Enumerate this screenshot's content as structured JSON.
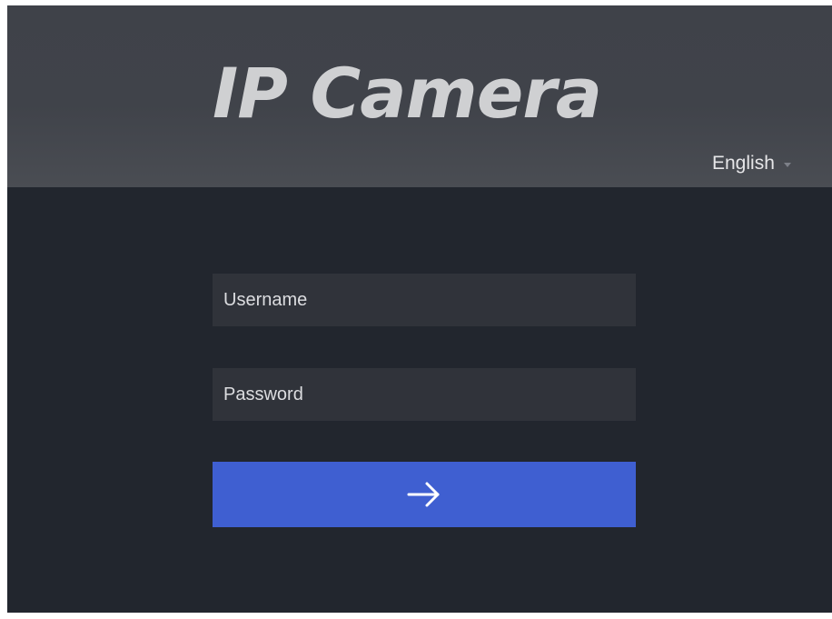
{
  "app": {
    "logo_text": "IP Camera"
  },
  "language": {
    "selected": "English",
    "caret_icon": "caret-down-icon"
  },
  "login": {
    "username_placeholder": "Username",
    "password_placeholder": "Password",
    "username_value": "",
    "password_value": "",
    "submit_icon": "arrow-right-icon"
  },
  "colors": {
    "header_bg": "#404349",
    "body_bg": "#22262e",
    "field_bg": "#30333a",
    "accent": "#3f5fd1",
    "logo_text": "#cfd0d2"
  }
}
